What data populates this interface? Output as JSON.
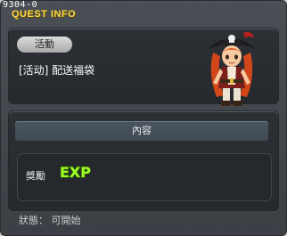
{
  "window": {
    "quest_id": "9304-0",
    "title": "QUEST INFO"
  },
  "quest": {
    "category_badge": "活動",
    "name": "[活动] 配送福袋"
  },
  "details": {
    "content_header": "內容",
    "reward_label": "獎勵",
    "reward_icon": "exp-icon",
    "reward_icon_text": "EXP"
  },
  "status": {
    "text": "狀態： 可開始"
  },
  "colors": {
    "title": "#ffd94a",
    "exp_green": "#9cff2a",
    "panel": "#2a2e32",
    "window": "#444a50"
  }
}
